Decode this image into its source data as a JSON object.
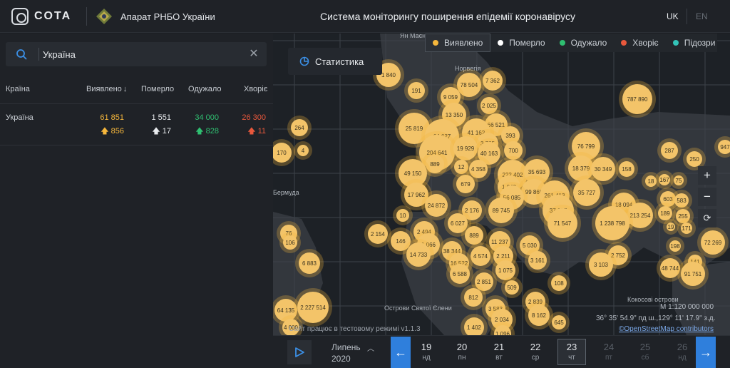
{
  "header": {
    "brand": "COTA",
    "org": "Апарат РНБО України",
    "title": "Система моніторингу поширення епідемії коронавірусу",
    "lang_uk": "UK",
    "lang_en": "EN"
  },
  "sidebar": {
    "search_value": "Україна",
    "columns": [
      "Країна",
      "Виявлено",
      "Померло",
      "Одужало",
      "Хворіє"
    ],
    "sort_icon": "arrow-down-icon",
    "row": {
      "country": "Україна",
      "detected": "61 851",
      "detected_delta": "856",
      "died": "1 551",
      "died_delta": "17",
      "recovered": "34 000",
      "recovered_delta": "828",
      "sick": "26 300",
      "sick_delta": "11"
    }
  },
  "map": {
    "stat_button": "Статистика",
    "legend": [
      {
        "label": "Виявлено",
        "color": "#f6b73c",
        "active": true
      },
      {
        "label": "Померло",
        "color": "#ffffff",
        "active": false
      },
      {
        "label": "Одужало",
        "color": "#2fbf71",
        "active": false
      },
      {
        "label": "Хворіє",
        "color": "#e8583c",
        "active": false
      },
      {
        "label": "Підозри",
        "color": "#33c3b8",
        "active": false
      }
    ],
    "place_labels": [
      "Ян Маєн",
      "Норвегія",
      "Бермуда",
      "Острови Святої Єлени",
      "Кокосові острови"
    ],
    "bubbles": [
      "1 840",
      "191",
      "78 504",
      "7 362",
      "9 059",
      "2 025",
      "787 890",
      "13 350",
      "25 819",
      "64 627",
      "66 521",
      "41 162",
      "393",
      "76 799",
      "3 765",
      "204 641",
      "19 929",
      "40 163",
      "700",
      "264",
      "287",
      "947",
      "170",
      "4",
      "889",
      "12",
      "4 358",
      "18 379",
      "30 349",
      "158",
      "250",
      "49 150",
      "222 402",
      "35 693",
      "167",
      "75",
      "679",
      "1 040",
      "99 865",
      "261 413",
      "35 727",
      "18",
      "603",
      "583",
      "17 962",
      "56 085",
      "18 094",
      "92",
      "24 872",
      "2 176",
      "89 745",
      "37 637",
      "213 254",
      "189",
      "255",
      "10",
      "71 547",
      "1 238 798",
      "19",
      "171",
      "6 027",
      "76",
      "2 494",
      "889",
      "11 237",
      "5 030",
      "72 269",
      "2 154",
      "146",
      "1 066",
      "106",
      "38 344",
      "4 574",
      "2 211",
      "3 161",
      "2 752",
      "198",
      "14 733",
      "16 522",
      "6 883",
      "6 588",
      "1 075",
      "3 103",
      "48 744",
      "141",
      "91 751",
      "2 851",
      "108",
      "509",
      "812",
      "2 839",
      "64 135",
      "2 227 514",
      "3 583",
      "8 162",
      "2 034",
      "645",
      "4 000",
      "1 402",
      "1 096"
    ],
    "scale": "М 1:120 000 000",
    "coords": "36° 35' 54.9\" пд ш.,129° 11' 17.9\" з.д.",
    "attribution": "©OpenStreetMap contributors",
    "test_mode": "Сайт працює в тестовому режимі v1.1.3"
  },
  "timeline": {
    "month": "Липень",
    "year": "2020",
    "days": [
      {
        "n": "19",
        "w": "нд",
        "state": "normal"
      },
      {
        "n": "20",
        "w": "пн",
        "state": "normal"
      },
      {
        "n": "21",
        "w": "вт",
        "state": "normal"
      },
      {
        "n": "22",
        "w": "ср",
        "state": "normal"
      },
      {
        "n": "23",
        "w": "чт",
        "state": "selected"
      },
      {
        "n": "24",
        "w": "пт",
        "state": "dim"
      },
      {
        "n": "25",
        "w": "сб",
        "state": "dim"
      },
      {
        "n": "26",
        "w": "нд",
        "state": "dim"
      }
    ]
  }
}
